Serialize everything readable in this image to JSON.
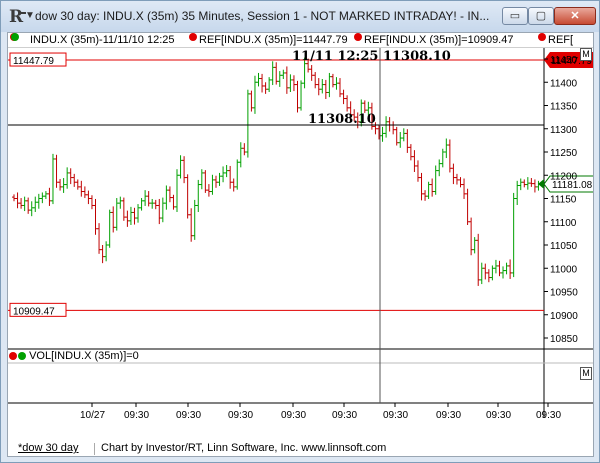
{
  "window": {
    "title": "dow 30 day: INDU.X (35m) 35 Minutes, Session 1 - NOT MARKED INTRADAY! - IN...",
    "icon": "investor-rt-logo-icon",
    "buttons": {
      "minimize": "▭",
      "maximize": "▢",
      "close": "✕"
    }
  },
  "legend": {
    "series": "INDU.X (35m)-11/11/10 12:25",
    "ref1": "REF[INDU.X (35m)]=11447.79",
    "ref2": "REF[INDU.X (35m)]=10909.47",
    "ref3": "REF[",
    "box": "M"
  },
  "price_panel": {
    "crosshair_label": "11/11 12:25  11308.10",
    "crosshair_value_label": "11308.10",
    "ref_high_label": "11447.79",
    "ref_low_label": "10909.47",
    "ref_high_axis": "11447.79",
    "last_price_axis": "11181.08",
    "colors": {
      "up": "#00a000",
      "down": "#c00000",
      "ref_line": "#e00000",
      "last_price": "#007a00",
      "crosshair": "#000000"
    }
  },
  "volume_panel": {
    "legend": "VOL[INDU.X (35m)]=0",
    "box": "M"
  },
  "status_bar": {
    "link": "*dow 30 day",
    "credit": "Chart by Investor/RT, Linn Software, Inc. www.linnsoft.com"
  },
  "chart_data": {
    "type": "candlestick",
    "title": "",
    "ylim": [
      10830,
      11470
    ],
    "y_ticks": [
      10850,
      10900,
      10950,
      11000,
      11050,
      11100,
      11150,
      11200,
      11250,
      11300,
      11350,
      11400,
      11450
    ],
    "x_tick_labels": [
      "10/27",
      "09:30",
      "09:30",
      "09:30",
      "09:30",
      "09:30",
      "09:30",
      "09:30",
      "09:30",
      "09:30"
    ],
    "reference_lines": [
      11447.79,
      10909.47
    ],
    "crosshair": {
      "time": "11/11 12:25",
      "value": 11308.1
    },
    "last_price": 11181.08,
    "series": [
      {
        "name": "INDU.X (35m)",
        "values": [
          11150,
          11140,
          11135,
          11145,
          11125,
          11130,
          11142,
          11150,
          11155,
          11160,
          11145,
          11235,
          11185,
          11175,
          11180,
          11205,
          11195,
          11185,
          11175,
          11165,
          11158,
          11150,
          11135,
          11085,
          11040,
          11025,
          11050,
          11120,
          11088,
          11140,
          11145,
          11110,
          11102,
          11120,
          11108,
          11130,
          11145,
          11155,
          11140,
          11140,
          11135,
          11108,
          11140,
          11168,
          11152,
          11132,
          11200,
          11232,
          11195,
          11115,
          11070,
          11135,
          11180,
          11205,
          11168,
          11165,
          11190,
          11185,
          11198,
          11205,
          11210,
          11185,
          11175,
          11228,
          11258,
          11250,
          11375,
          11345,
          11400,
          11408,
          11392,
          11385,
          11405,
          11432,
          11402,
          11415,
          11420,
          11388,
          11405,
          11395,
          11345,
          11398,
          11440,
          11428,
          11415,
          11395,
          11385,
          11395,
          11378,
          11412,
          11395,
          11398,
          11375,
          11365,
          11345,
          11330,
          11325,
          11315,
          11355,
          11340,
          11345,
          11305,
          11300,
          11285,
          11290,
          11315,
          11308,
          11298,
          11270,
          11280,
          11290,
          11260,
          11240,
          11220,
          11195,
          11160,
          11155,
          11180,
          11165,
          11210,
          11225,
          11250,
          11265,
          11215,
          11195,
          11190,
          11180,
          11160,
          11100,
          11040,
          11060,
          10975,
          11000,
          10990,
          10980,
          11000,
          11005,
          10990,
          10995,
          11005,
          10990,
          11150,
          11178,
          11185,
          11180,
          11183,
          11182,
          11175,
          11181
        ]
      }
    ]
  }
}
